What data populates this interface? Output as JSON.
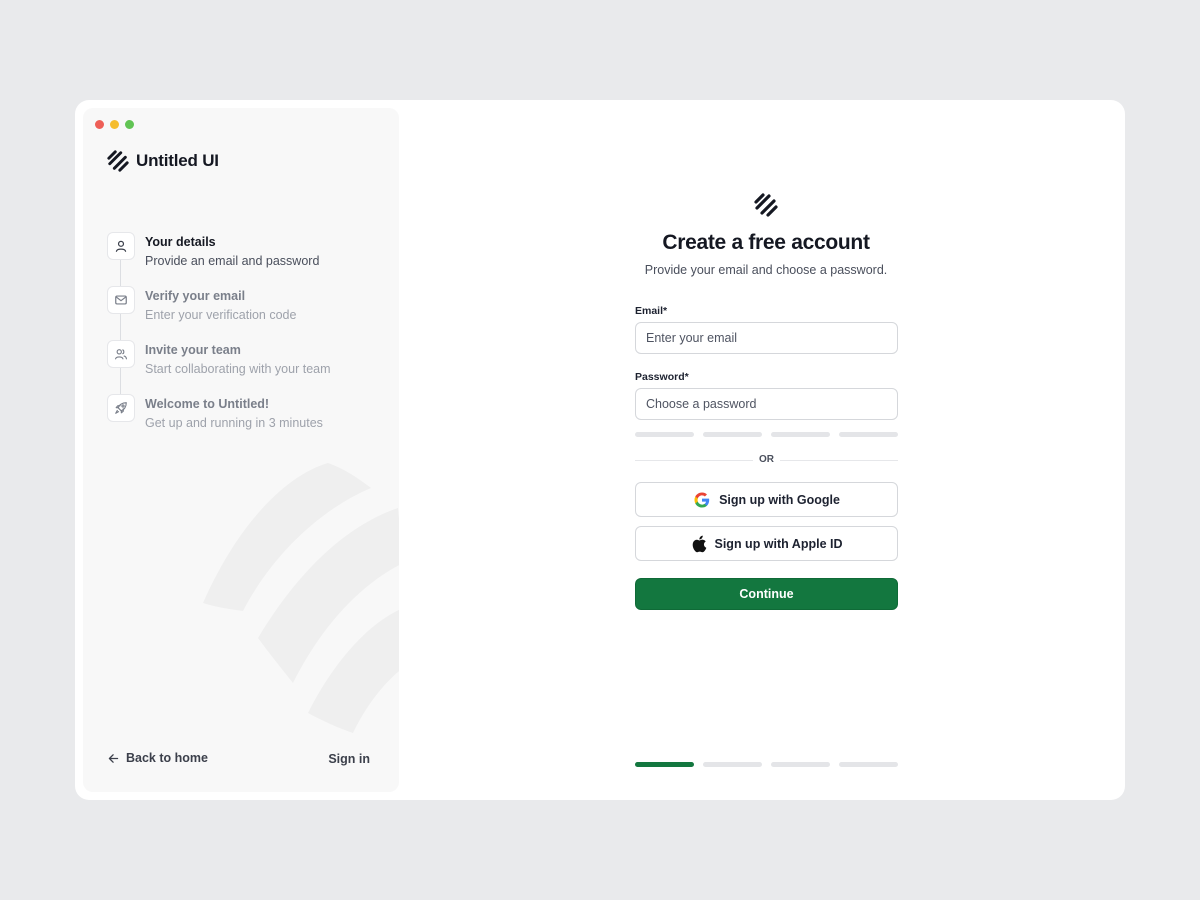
{
  "window": {
    "traffic_lights": [
      "#ee5f57",
      "#f5bd2e",
      "#61c454"
    ]
  },
  "sidebar": {
    "brand": {
      "name": "Untitled UI",
      "logo_icon": "untitled-ui-logo-icon"
    },
    "steps": [
      {
        "title": "Your details",
        "description": "Provide an email and password",
        "icon": "user-icon",
        "state": "active"
      },
      {
        "title": "Verify your email",
        "description": "Enter your verification code",
        "icon": "mail-icon",
        "state": "inactive"
      },
      {
        "title": "Invite your team",
        "description": "Start collaborating with your team",
        "icon": "users-icon",
        "state": "inactive"
      },
      {
        "title": "Welcome to Untitled!",
        "description": "Get up and running in 3 minutes",
        "icon": "rocket-icon",
        "state": "inactive"
      }
    ],
    "back_link": {
      "label": "Back to home",
      "icon": "arrow-left-icon"
    },
    "signin_link": "Sign in"
  },
  "main": {
    "logo_icon": "untitled-ui-logo-icon",
    "title": "Create a free account",
    "subtitle": "Provide your email and choose a password.",
    "email": {
      "label": "Email*",
      "placeholder": "Enter your email",
      "value": ""
    },
    "password": {
      "label": "Password*",
      "placeholder": "Choose a password",
      "value": ""
    },
    "password_strength_filled": 0,
    "divider_text": "OR",
    "google_button": {
      "label": "Sign up with Google",
      "icon": "google-icon"
    },
    "apple_button": {
      "label": "Sign up with Apple ID",
      "icon": "apple-icon"
    },
    "continue_button": "Continue",
    "progress": {
      "current_step": 1,
      "total_steps": 4
    }
  },
  "colors": {
    "accent": "#13773f",
    "page_background": "#e9eaec",
    "sidebar_background": "#f8f8f8"
  }
}
